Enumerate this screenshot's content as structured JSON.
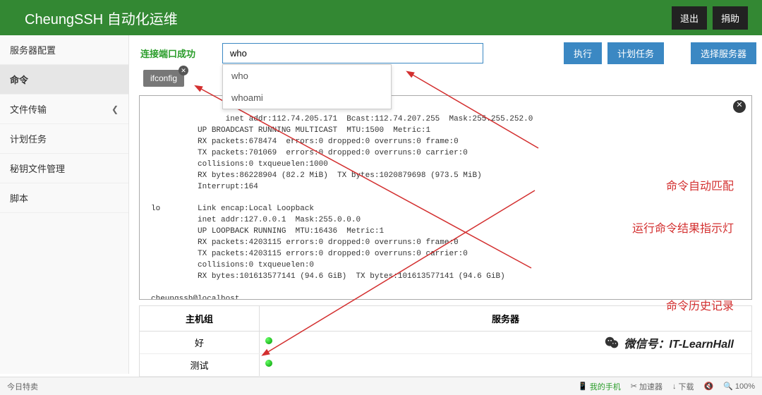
{
  "header": {
    "brand": "CheungSSH 自动化运维",
    "logout": "退出",
    "donate": "捐助"
  },
  "sidebar": {
    "items": [
      {
        "label": "服务器配置"
      },
      {
        "label": "命令",
        "active": true
      },
      {
        "label": "文件传输",
        "has_chevron": true
      },
      {
        "label": "计划任务"
      },
      {
        "label": "秘钥文件管理"
      },
      {
        "label": "脚本"
      }
    ]
  },
  "command": {
    "conn_status": "连接端口成功",
    "input_value": "who",
    "exec_btn": "执行",
    "plan_btn": "计划任务",
    "select_btn": "选择服务器",
    "suggestions": [
      "who",
      "whoami"
    ],
    "history_tag": "ifconfig"
  },
  "terminal": {
    "lines": "          inet addr:112.74.205.171  Bcast:112.74.207.255  Mask:255.255.252.0\n          UP BROADCAST RUNNING MULTICAST  MTU:1500  Metric:1\n          RX packets:678474  errors:0 dropped:0 overruns:0 frame:0\n          TX packets:701069  errors:0 dropped:0 overruns:0 carrier:0\n          collisions:0 txqueuelen:1000\n          RX bytes:86228904 (82.2 MiB)  TX bytes:1020879698 (973.5 MiB)\n          Interrupt:164\n\nlo        Link encap:Local Loopback\n          inet addr:127.0.0.1  Mask:255.0.0.0\n          UP LOOPBACK RUNNING  MTU:16436  Metric:1\n          RX packets:4203115 errors:0 dropped:0 overruns:0 frame:0\n          TX packets:4203115 errors:0 dropped:0 overruns:0 carrier:0\n          collisions:0 txqueuelen:0\n          RX bytes:101613577141 (94.6 GiB)  TX bytes:101613577141 (94.6 GiB)\n\ncheungssh@localhost"
  },
  "host_table": {
    "col_group": "主机组",
    "col_server": "服务器",
    "rows": [
      {
        "group": "好"
      },
      {
        "group": "测试"
      }
    ]
  },
  "annotations": {
    "a1": "命令自动匹配",
    "a2": "运行命令结果指示灯",
    "a3": "命令历史记录"
  },
  "wechat": {
    "label": "微信号：IT-LearnHall"
  },
  "statusbar": {
    "left": "今日特卖",
    "phone": "我的手机",
    "accel": "加速器",
    "download": "下载",
    "zoom": "100%"
  }
}
